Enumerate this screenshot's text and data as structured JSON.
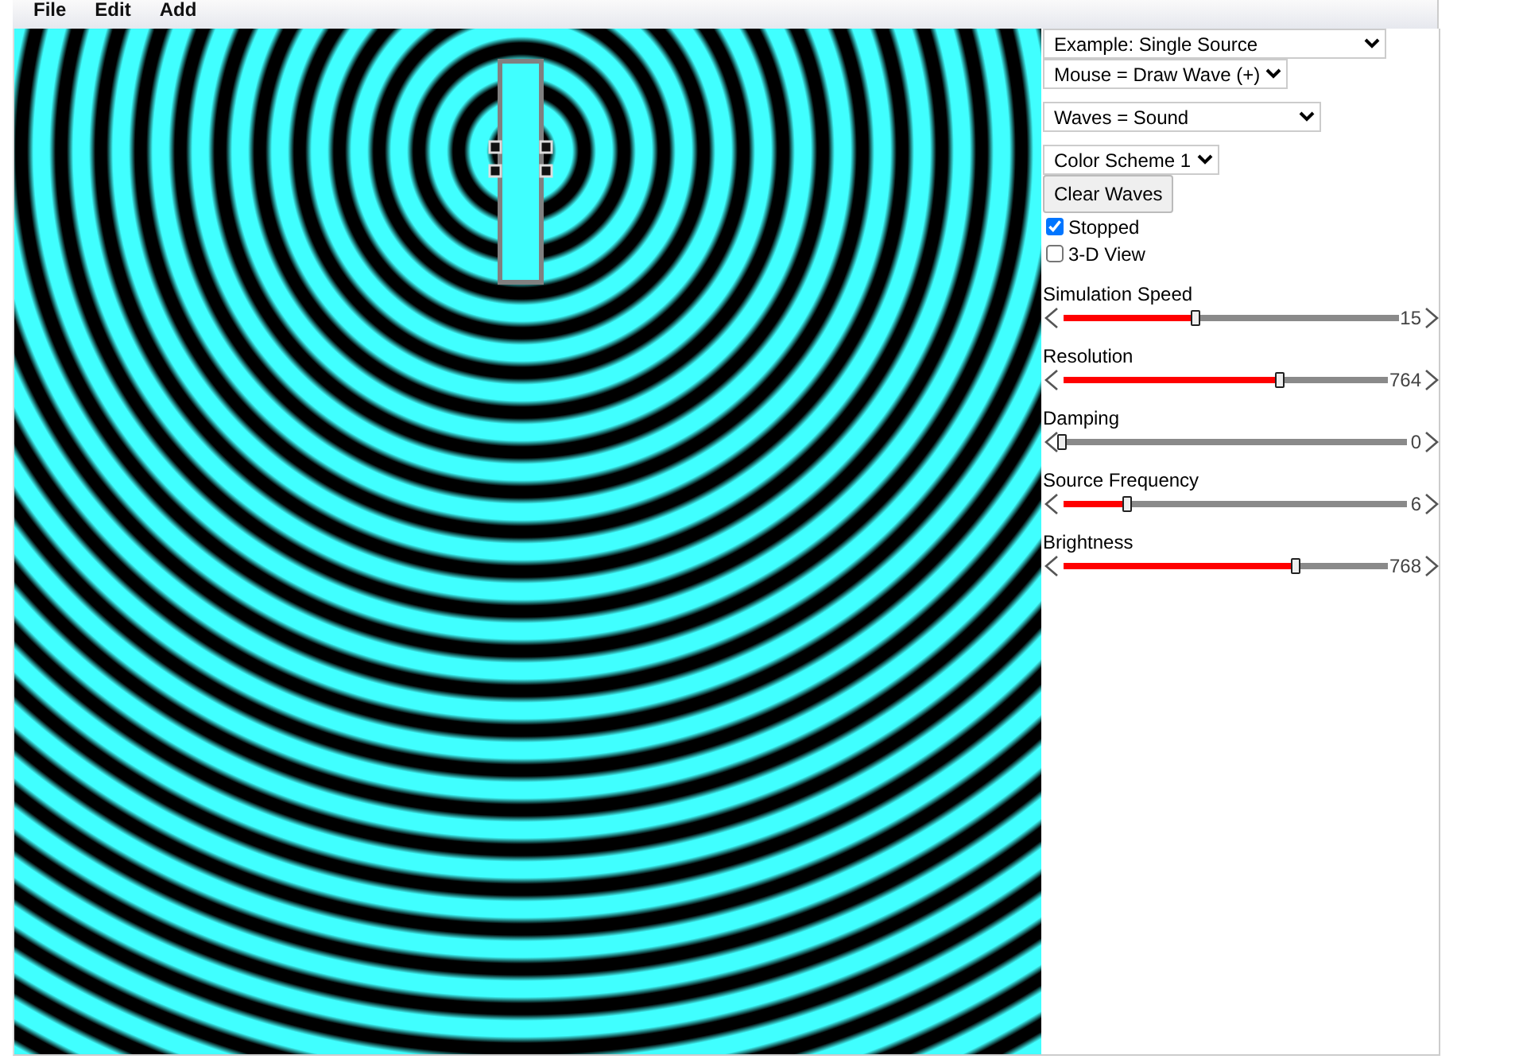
{
  "menu": [
    "File",
    "Edit",
    "Add"
  ],
  "controls": [
    {
      "kind": "select",
      "value": "Example: Single Source"
    },
    {
      "kind": "select",
      "value": "Mouse = Draw Wave (+)"
    },
    {
      "kind": "select",
      "value": "Waves = Sound"
    },
    {
      "kind": "select",
      "value": "Color Scheme 1"
    },
    {
      "kind": "button",
      "label": "Clear Waves"
    },
    {
      "kind": "checkbox",
      "label": "Stopped",
      "checked": true
    },
    {
      "kind": "checkbox",
      "label": "3-D View",
      "checked": false
    }
  ],
  "sliders": [
    {
      "label": "Simulation Speed",
      "level": 0.4,
      "reading": "15"
    },
    {
      "label": "Resolution",
      "level": 0.67,
      "reading": "764"
    },
    {
      "label": "Damping",
      "level": 0,
      "reading": "0"
    },
    {
      "label": "Source Frequency",
      "level": 0.19,
      "reading": "6"
    },
    {
      "label": "Brightness",
      "level": 0.72,
      "reading": "768"
    }
  ]
}
